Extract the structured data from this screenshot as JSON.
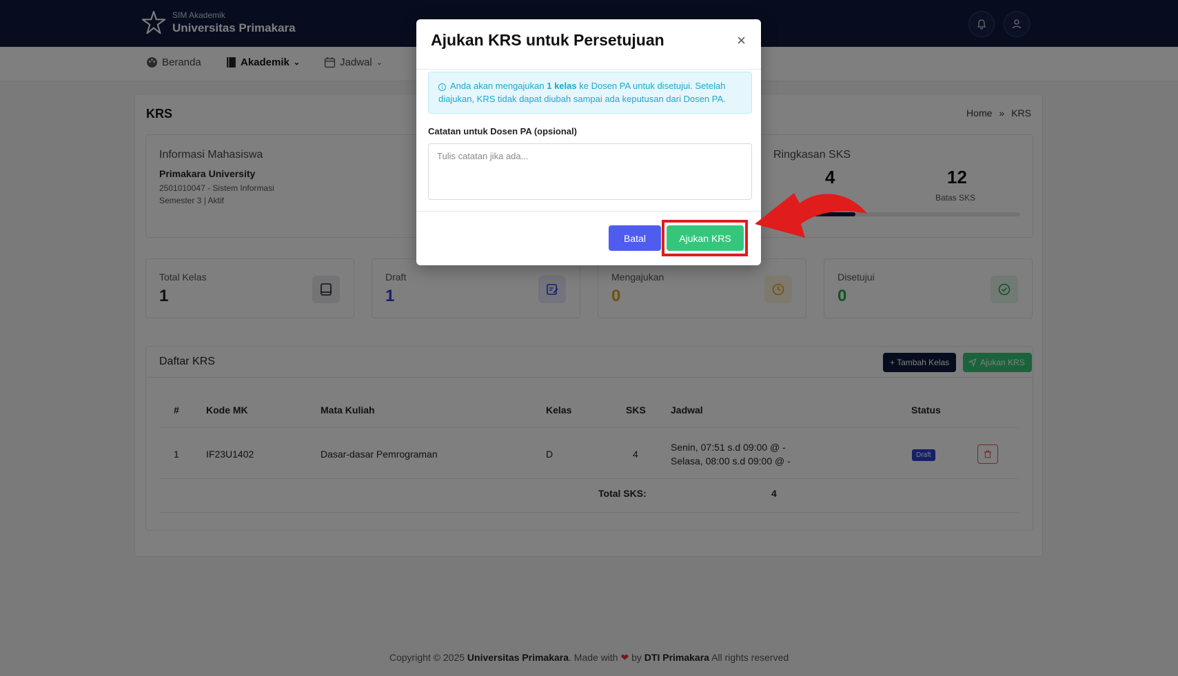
{
  "topbar": {
    "brand_small": "SIM Akademik",
    "brand_big": "Universitas Primakara",
    "bg_color": "#0f1a3c"
  },
  "nav": {
    "items": [
      {
        "label": "Beranda",
        "icon": "palette-icon"
      },
      {
        "label": "Akademik",
        "icon": "book-icon",
        "active": true
      },
      {
        "label": "Jadwal",
        "icon": "calendar-icon"
      }
    ]
  },
  "page": {
    "title": "KRS",
    "breadcrumb": [
      "Home",
      "»",
      "KRS"
    ]
  },
  "student": {
    "heading": "Informasi Mahasiswa",
    "name": "Primakara University",
    "nim_prodi": "2501010047 - Sistem Informasi",
    "semester": "Semester 3 | Aktif"
  },
  "sks_summary": {
    "heading": "Ringkasan SKS",
    "taken": "4",
    "limit": "12",
    "limit_label": "Batas SKS",
    "progress": 0.333
  },
  "stats": [
    {
      "label": "Total Kelas",
      "value": "1",
      "color": "#222222",
      "icon": "book-icon"
    },
    {
      "label": "Draft",
      "value": "1",
      "color": "#2f3fd6",
      "icon": "edit-icon"
    },
    {
      "label": "Mengajukan",
      "value": "0",
      "color": "#e0a21a",
      "icon": "clock-icon"
    },
    {
      "label": "Disetujui",
      "value": "0",
      "color": "#28a745",
      "icon": "check-circle-icon"
    }
  ],
  "krs_list": {
    "heading": "Daftar KRS",
    "add_button": "+ Tambah Kelas",
    "submit_button": "Ajukan KRS",
    "columns": [
      "#",
      "Kode MK",
      "Mata Kuliah",
      "Kelas",
      "SKS",
      "Jadwal",
      "Status"
    ],
    "rows": [
      {
        "no": "1",
        "code": "IF23U1402",
        "course": "Dasar-dasar Pemrograman",
        "class": "D",
        "sks": "4",
        "schedule_1": "Senin, 07:51 s.d 09:00 @ -",
        "schedule_2": "Selasa, 08:00 s.d 09:00 @ -",
        "status": "Draft"
      }
    ],
    "total_label": "Total SKS:",
    "total_value": "4"
  },
  "footer": {
    "prefix": "Copyright © 2025",
    "org": "Universitas Primakara",
    "made_with": ". Made with",
    "by": "by",
    "team": "DTI Primakara",
    "suffix": "All rights reserved"
  },
  "modal": {
    "title": "Ajukan KRS untuk Persetujuan",
    "close": "×",
    "alert_pre": "Anda akan mengajukan",
    "alert_bold": "1 kelas",
    "alert_post": "ke Dosen PA untuk disetujui. Setelah diajukan, KRS tidak dapat diubah sampai ada keputusan dari Dosen PA.",
    "note_label": "Catatan untuk Dosen PA (opsional)",
    "note_placeholder": "Tulis catatan jika ada...",
    "note_value": "",
    "cancel": "Batal",
    "submit": "Ajukan KRS"
  }
}
